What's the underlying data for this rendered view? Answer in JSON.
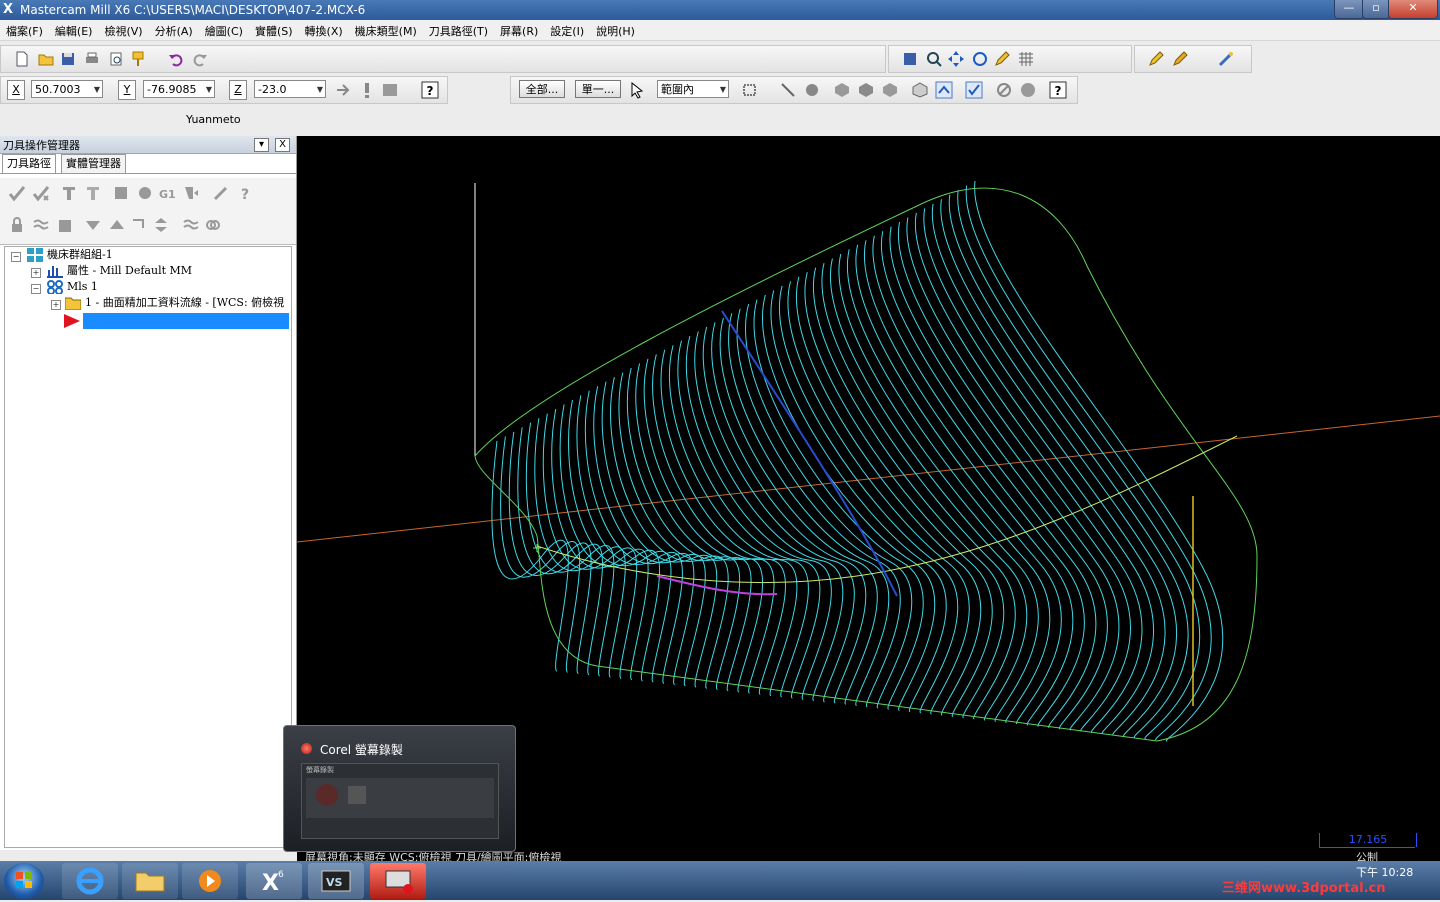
{
  "window": {
    "title": "Mastercam Mill X6  C:\\USERS\\MACI\\DESKTOP\\407-2.MCX-6",
    "minimize_glyph": "—",
    "maximize_glyph": "▫",
    "close_glyph": "✕"
  },
  "menubar": [
    "檔案(F)",
    "編輯(E)",
    "檢視(V)",
    "分析(A)",
    "繪圖(C)",
    "實體(S)",
    "轉換(X)",
    "機床類型(M)",
    "刀具路徑(T)",
    "屏幕(R)",
    "設定(I)",
    "說明(H)"
  ],
  "coords": {
    "x_label": "X",
    "x_value": "50.7003",
    "y_label": "Y",
    "y_value": "-76.9085",
    "z_label": "Z",
    "z_value": "-23.0"
  },
  "selection_bar": {
    "all_button": "全部...",
    "single_button": "單一...",
    "range_select": "範圍內"
  },
  "user_label": "Yuanmeto",
  "panel": {
    "title": "刀具操作管理器",
    "dropdown_glyph": "▾",
    "close_glyph": "X",
    "tabs": [
      "刀具路徑",
      "實體管理器"
    ],
    "tree": {
      "root": "機床群組組-1",
      "properties": "屬性 - Mill Default MM",
      "machine": "Mls 1",
      "operation": "1 - 曲面精加工資料流線 - [WCS: 俯檢視"
    }
  },
  "viewport": {
    "status_text": "屏幕視角:未顯存   WCS:俯檢視   刀具/繪圖平面:俯檢視",
    "scale_value": "17.165",
    "units": "公制"
  },
  "corel_popup": {
    "title": "Corel 螢幕錄製",
    "subtitle": "螢幕錄製"
  },
  "taskbar": {
    "time": "下午 10:28",
    "watermark": "三维网www.3dportal.cn"
  },
  "colors": {
    "toolpath_cyan": "#3fd9e6",
    "surface_green": "#5fd35a",
    "axis_orange": "#c8652f",
    "selection_blue": "#1a8cff"
  }
}
